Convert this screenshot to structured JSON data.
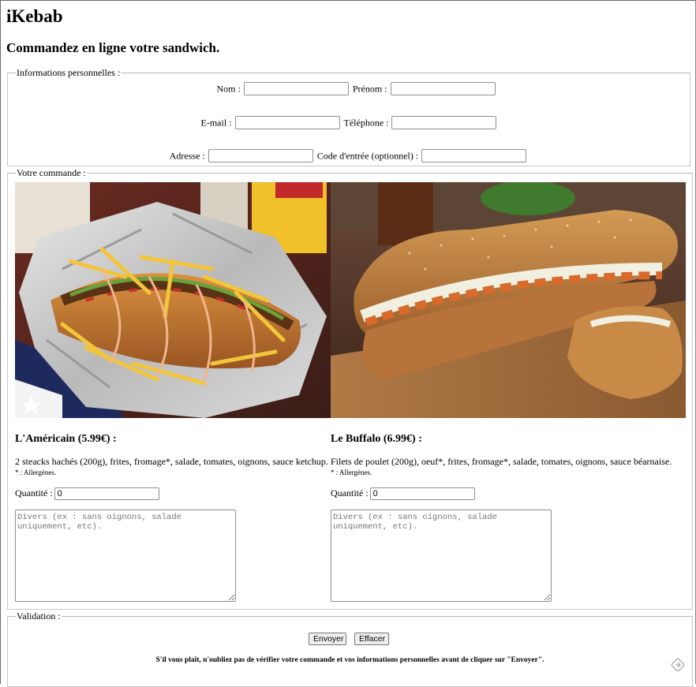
{
  "header": {
    "title": "iKebab",
    "subtitle": "Commandez en ligne votre sandwich."
  },
  "personal": {
    "legend": "Informations personnelles :",
    "nom_label": "Nom :",
    "prenom_label": "Prénom :",
    "email_label": "E-mail :",
    "telephone_label": "Téléphone :",
    "adresse_label": "Adresse :",
    "code_label": "Code d'entrée (optionnel) :",
    "nom_value": "",
    "prenom_value": "",
    "email_value": "",
    "telephone_value": "",
    "adresse_value": "",
    "code_value": ""
  },
  "order": {
    "legend": "Votre commande :",
    "products": [
      {
        "title": "L'Américain (5.99€) :",
        "description": "2 steacks hachés (200g), frites, fromage*, salade, tomates, oignons, sauce ketchup.",
        "allergen_note": "* : Allergènes.",
        "quantity_label": "Quantité :",
        "quantity_value": "0",
        "notes_placeholder": "Divers (ex : sans oignons, salade uniquement, etc).",
        "image_icon": "hotdog-fries-photo"
      },
      {
        "title": "Le Buffalo (6.99€) :",
        "description": "Filets de poulet (200g), oeuf*, frites, fromage*, salade, tomates, oignons, sauce béarnaise.",
        "allergen_note": "* : Allergènes.",
        "quantity_label": "Quantité :",
        "quantity_value": "0",
        "notes_placeholder": "Divers (ex : sans oignons, salade uniquement, etc).",
        "image_icon": "buffalo-sandwich-photo"
      }
    ]
  },
  "validation": {
    "legend": "Validation :",
    "submit_label": "Envoyer",
    "reset_label": "Effacer",
    "warning": "S'il vous plaît, n'oubliez pas de vérifier votre commande et vos informations personnelles avant de cliquer sur \"Envoyer\".",
    "corner_icon": "translate-icon"
  }
}
